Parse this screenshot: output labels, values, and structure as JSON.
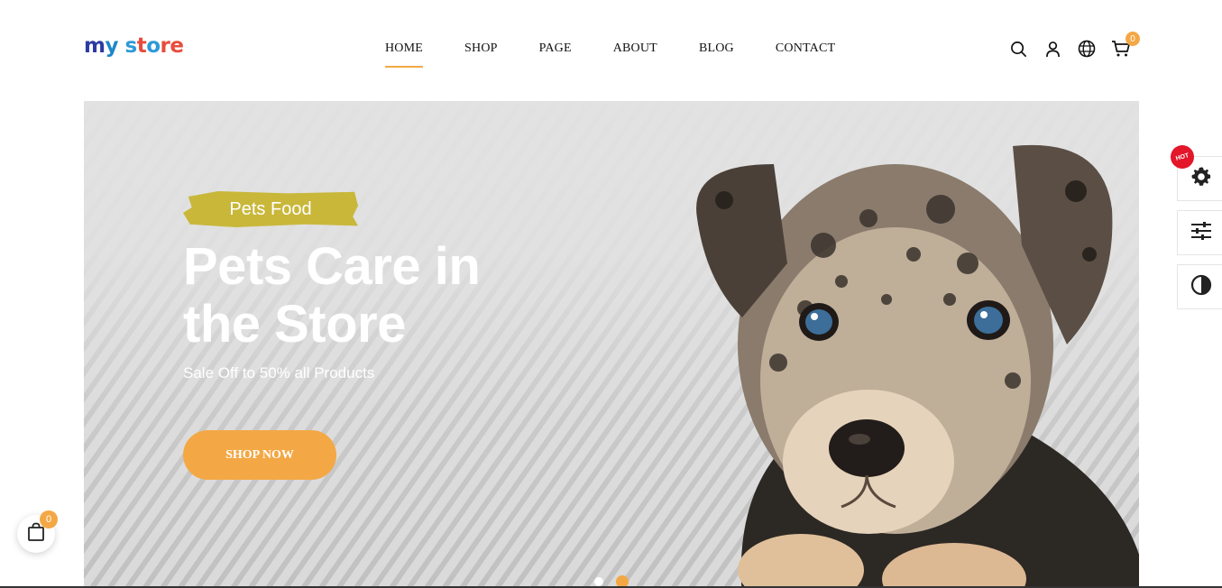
{
  "logo": {
    "letters": [
      "m",
      "y",
      " ",
      "s",
      "t",
      "o",
      "r",
      "e"
    ],
    "colors": [
      "#2d3aa3",
      "#1e88c9",
      "#ffffff",
      "#2d9ad8",
      "#e74c3c",
      "#2d9ad8",
      "#e74c3c",
      "#e74c3c"
    ]
  },
  "nav": {
    "items": [
      {
        "label": "HOME",
        "active": true
      },
      {
        "label": "SHOP",
        "active": false
      },
      {
        "label": "PAGE",
        "active": false
      },
      {
        "label": "ABOUT",
        "active": false
      },
      {
        "label": "BLOG",
        "active": false
      },
      {
        "label": "CONTACT",
        "active": false
      }
    ]
  },
  "header": {
    "icons": [
      "search-icon",
      "user-icon",
      "globe-icon",
      "cart-icon"
    ],
    "cart_count": "0"
  },
  "hero": {
    "tag": "Pets Food",
    "title": "Pets Care in the Store",
    "subtitle": "Sale Off to 50% all Products",
    "button": "SHOP NOW",
    "slide_count": 2,
    "active_slide": 2
  },
  "side_panel": {
    "hot_label": "HOT",
    "icons": [
      "gear-icon",
      "sliders-icon",
      "contrast-icon"
    ]
  },
  "float_cart": {
    "count": "0"
  },
  "colors": {
    "accent": "#f3a845",
    "tag": "#c9b73a",
    "hot": "#e3162a"
  }
}
